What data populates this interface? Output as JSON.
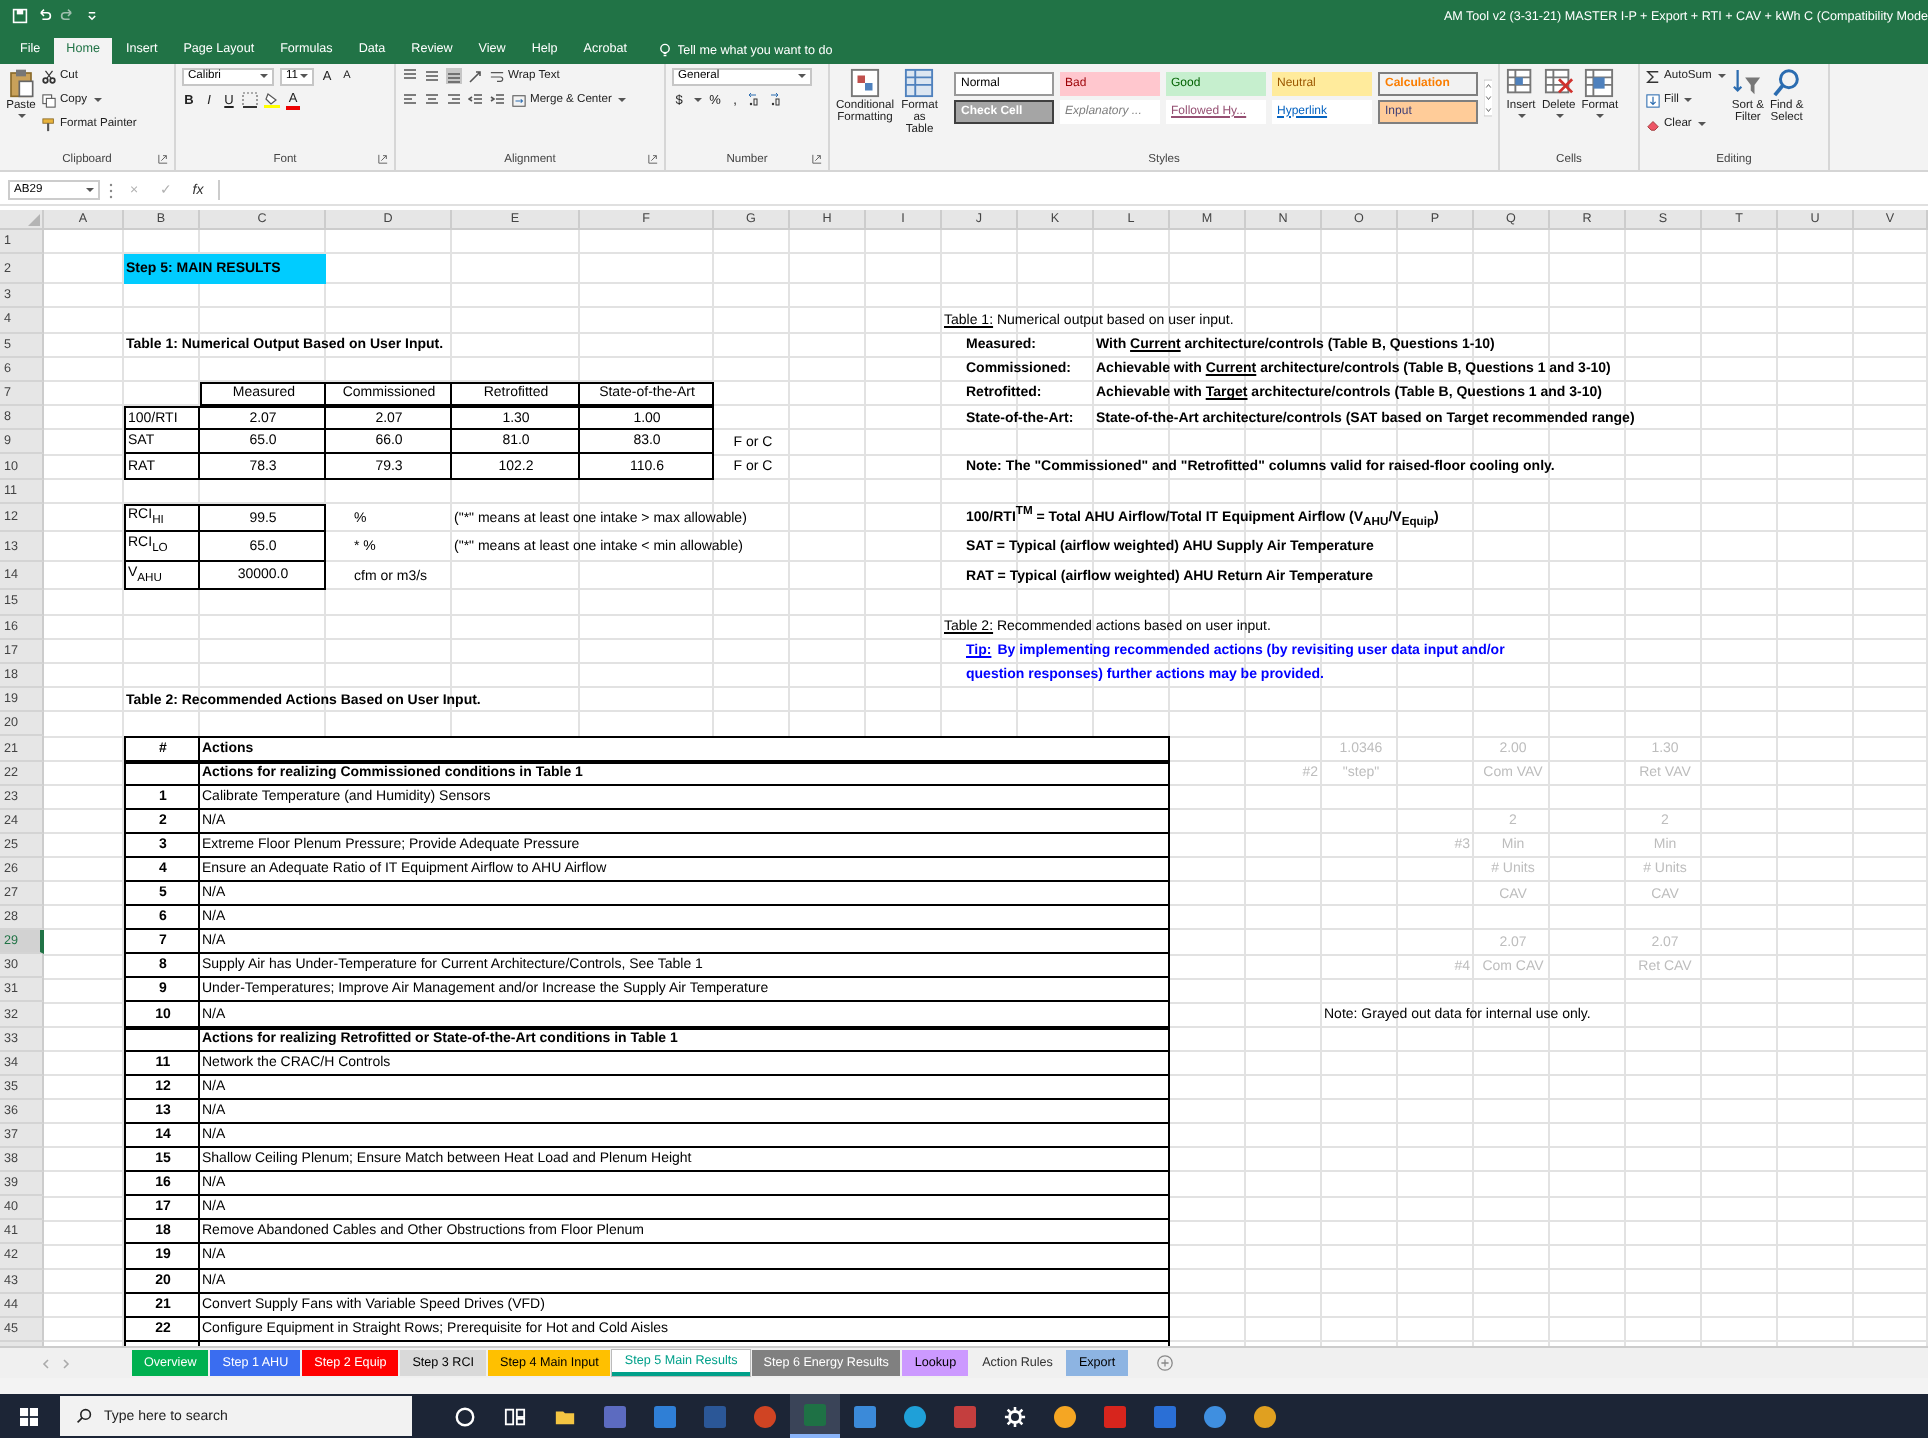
{
  "window": {
    "title": "AM Tool v2  (3-31-21) MASTER I-P + Export + RTI + CAV + kWh C  (Compatibility Mode"
  },
  "menu_tabs": [
    {
      "label": "File",
      "selected": false
    },
    {
      "label": "Home",
      "selected": true
    },
    {
      "label": "Insert",
      "selected": false
    },
    {
      "label": "Page Layout",
      "selected": false
    },
    {
      "label": "Formulas",
      "selected": false
    },
    {
      "label": "Data",
      "selected": false
    },
    {
      "label": "Review",
      "selected": false
    },
    {
      "label": "View",
      "selected": false
    },
    {
      "label": "Help",
      "selected": false
    },
    {
      "label": "Acrobat",
      "selected": false
    }
  ],
  "tell_me": {
    "placeholder": "Tell me what you want to do"
  },
  "ribbon": {
    "clipboard": {
      "paste": "Paste",
      "cut": "Cut",
      "copy": "Copy",
      "format_painter": "Format Painter",
      "label": "Clipboard"
    },
    "font": {
      "name": "Calibri",
      "size": "11",
      "grow": "A",
      "shrink": "A",
      "bold": "B",
      "italic": "I",
      "underline": "U",
      "color_letter": "A",
      "label": "Font"
    },
    "alignment": {
      "wrap_text": "Wrap Text",
      "merge": "Merge & Center",
      "label": "Alignment"
    },
    "number": {
      "format": "General",
      "currency": "$",
      "percent": "%",
      "comma": ",",
      "label": "Number"
    },
    "styles": {
      "conditional": [
        "Conditional",
        "Formatting"
      ],
      "format_table": [
        "Format as",
        "Table"
      ],
      "label": "Styles",
      "cells": [
        {
          "label": "Normal",
          "kind": "normal"
        },
        {
          "label": "Bad",
          "kind": "bad"
        },
        {
          "label": "Good",
          "kind": "good"
        },
        {
          "label": "Neutral",
          "kind": "neutral"
        },
        {
          "label": "Calculation",
          "kind": "calculation"
        },
        {
          "label": "Check Cell",
          "kind": "check"
        },
        {
          "label": "Explanatory ...",
          "kind": "explanatory"
        },
        {
          "label": "Followed Hy...",
          "kind": "followed"
        },
        {
          "label": "Hyperlink",
          "kind": "hyperlink"
        },
        {
          "label": "Input",
          "kind": "input"
        }
      ]
    },
    "cells": {
      "insert": "Insert",
      "delete": "Delete",
      "format": "Format",
      "label": "Cells"
    },
    "editing": {
      "autosum": "AutoSum",
      "fill": "Fill",
      "clear": "Clear",
      "sort": [
        "Sort &",
        "Filter"
      ],
      "find": [
        "Find &",
        "Select"
      ],
      "label": "Editing"
    }
  },
  "formula_bar": {
    "name_box": "AB29",
    "cancel": "×",
    "enter": "✓",
    "function": "fx"
  },
  "sheet": {
    "columns": [
      "A",
      "B",
      "C",
      "D",
      "E",
      "F",
      "G",
      "H",
      "I",
      "J",
      "K",
      "L",
      "M",
      "N",
      "O",
      "P",
      "Q",
      "R",
      "S",
      "T",
      "U",
      "V"
    ],
    "rows": [
      {
        "label": "1",
        "selected": false
      },
      {
        "label": "2",
        "selected": false
      },
      {
        "label": "3",
        "selected": false
      },
      {
        "label": "4",
        "selected": false
      },
      {
        "label": "5",
        "selected": false
      },
      {
        "label": "6",
        "selected": false
      },
      {
        "label": "7",
        "selected": false
      },
      {
        "label": "8",
        "selected": false
      },
      {
        "label": "9",
        "selected": false
      },
      {
        "label": "10",
        "selected": false
      },
      {
        "label": "11",
        "selected": false
      },
      {
        "label": "12",
        "selected": false
      },
      {
        "label": "13",
        "selected": false
      },
      {
        "label": "14",
        "selected": false
      },
      {
        "label": "15",
        "selected": false
      },
      {
        "label": "16",
        "selected": false
      },
      {
        "label": "17",
        "selected": false
      },
      {
        "label": "18",
        "selected": false
      },
      {
        "label": "19",
        "selected": false
      },
      {
        "label": "20",
        "selected": false
      },
      {
        "label": "21",
        "selected": false
      },
      {
        "label": "22",
        "selected": false
      },
      {
        "label": "23",
        "selected": false
      },
      {
        "label": "24",
        "selected": false
      },
      {
        "label": "25",
        "selected": false
      },
      {
        "label": "26",
        "selected": false
      },
      {
        "label": "27",
        "selected": false
      },
      {
        "label": "28",
        "selected": false
      },
      {
        "label": "29",
        "selected": true
      },
      {
        "label": "30",
        "selected": false
      },
      {
        "label": "31",
        "selected": false
      },
      {
        "label": "32",
        "selected": false
      },
      {
        "label": "33",
        "selected": false
      },
      {
        "label": "34",
        "selected": false
      },
      {
        "label": "35",
        "selected": false
      },
      {
        "label": "36",
        "selected": false
      },
      {
        "label": "37",
        "selected": false
      },
      {
        "label": "38",
        "selected": false
      },
      {
        "label": "39",
        "selected": false
      },
      {
        "label": "40",
        "selected": false
      },
      {
        "label": "41",
        "selected": false
      },
      {
        "label": "42",
        "selected": false
      },
      {
        "label": "43",
        "selected": false
      },
      {
        "label": "44",
        "selected": false
      },
      {
        "label": "45",
        "selected": false
      }
    ],
    "banner": "Step 5: MAIN RESULTS",
    "table1": {
      "title": "Table 1: Numerical Output Based on User Input.",
      "columns": [
        "Measured",
        "Commissioned",
        "Retrofitted",
        "State-of-the-Art"
      ],
      "rows": [
        {
          "label": "100/RTI",
          "values": [
            "2.07",
            "2.07",
            "1.30",
            "1.00"
          ]
        },
        {
          "label": "SAT",
          "values": [
            "65.0",
            "66.0",
            "81.0",
            "83.0"
          ],
          "unit": "F or C"
        },
        {
          "label": "RAT",
          "values": [
            "78.3",
            "79.3",
            "102.2",
            "110.6"
          ],
          "unit": "F or C"
        }
      ]
    },
    "indices": [
      {
        "label": "RCI$_{HI}$",
        "value": "99.5",
        "unit": "%",
        "note": "(\"*\" means at least one intake > max allowable)"
      },
      {
        "label": "RCI$_{LO}$",
        "value": "65.0",
        "unit": "* %",
        "note": "(\"*\" means at least one intake < min allowable)"
      },
      {
        "label": "V$_{AHU}$",
        "value": "30000.0",
        "unit": "cfm or m3/s"
      }
    ],
    "table2": {
      "title": "Table 2: Recommended Actions Based on User Input.",
      "columns": [
        "#",
        "Actions"
      ],
      "rows": [
        {
          "kind": "section",
          "text": "Actions for realizing Commissioned conditions in Table 1"
        },
        {
          "kind": "action",
          "number": "1",
          "text": "Calibrate Temperature (and Humidity) Sensors"
        },
        {
          "kind": "action",
          "number": "2",
          "text": "N/A"
        },
        {
          "kind": "action",
          "number": "3",
          "text": "Extreme Floor Plenum Pressure; Provide Adequate Pressure"
        },
        {
          "kind": "action",
          "number": "4",
          "text": "Ensure an Adequate Ratio of IT Equipment Airflow to AHU Airflow"
        },
        {
          "kind": "action",
          "number": "5",
          "text": "N/A"
        },
        {
          "kind": "action",
          "number": "6",
          "text": "N/A"
        },
        {
          "kind": "action",
          "number": "7",
          "text": "N/A"
        },
        {
          "kind": "action",
          "number": "8",
          "text": "Supply Air has Under-Temperature for Current Architecture/Controls, See Table 1"
        },
        {
          "kind": "action",
          "number": "9",
          "text": "Under-Temperatures; Improve Air Management and/or Increase the Supply Air Temperature"
        },
        {
          "kind": "action",
          "number": "10",
          "text": "N/A"
        },
        {
          "kind": "section",
          "text": "Actions for realizing Retrofitted or State-of-the-Art conditions in Table 1"
        },
        {
          "kind": "action",
          "number": "11",
          "text": "Network the CRAC/H Controls"
        },
        {
          "kind": "action",
          "number": "12",
          "text": "N/A"
        },
        {
          "kind": "action",
          "number": "13",
          "text": "N/A"
        },
        {
          "kind": "action",
          "number": "14",
          "text": "N/A"
        },
        {
          "kind": "action",
          "number": "15",
          "text": "Shallow Ceiling Plenum; Ensure Match between Heat Load and Plenum Height"
        },
        {
          "kind": "action",
          "number": "16",
          "text": "N/A"
        },
        {
          "kind": "action",
          "number": "17",
          "text": "N/A"
        },
        {
          "kind": "action",
          "number": "18",
          "text": "Remove Abandoned Cables and Other Obstructions from Floor Plenum"
        },
        {
          "kind": "action",
          "number": "19",
          "text": "N/A"
        },
        {
          "kind": "action",
          "number": "20",
          "text": "N/A"
        },
        {
          "kind": "action",
          "number": "21",
          "text": "Convert Supply Fans with Variable Speed Drives (VFD)"
        },
        {
          "kind": "action",
          "number": "22",
          "text": "Configure Equipment in Straight Rows; Prerequisite for Hot and Cold Aisles"
        }
      ]
    },
    "legend": {
      "table1_heading": "Table 1:",
      "table1_text": " Numerical output based on user input.",
      "definitions": [
        {
          "label": "Measured:",
          "before": "With ",
          "underlined": "Current",
          "after": " architecture/controls (Table B, Questions 1-10)"
        },
        {
          "label": "Commissioned:",
          "before": "Achievable with ",
          "underlined": "Current",
          "after": " architecture/controls (Table B, Questions 1 and 3-10)"
        },
        {
          "label": "Retrofitted:",
          "before": "Achievable with ",
          "underlined": "Target",
          "after": " architecture/controls (Table B, Questions 1 and 3-10)"
        },
        {
          "label": "State-of-the-Art:",
          "before": "State-of-the-Art architecture/controls (SAT based on Target recommended range)"
        }
      ],
      "note": "Note: The \"Commissioned\" and \"Retrofitted\" columns valid for raised-floor cooling only.",
      "formulas": [
        "100/RTI$^{TM}$ = Total AHU Airflow/Total IT Equipment Airflow (V$_{AHU}$/V$_{Equip}$)",
        "SAT = Typical (airflow weighted) AHU Supply Air Temperature",
        "RAT = Typical (airflow weighted) AHU Return Air Temperature"
      ],
      "table2_heading": "Table 2:",
      "table2_text": " Recommended actions based on user input.",
      "tip": {
        "label": "Tip:",
        "lines": [
          "By implementing recommended actions (by revisiting user data input and/or",
          "question responses) further actions may be provided."
        ]
      }
    },
    "internal_data": {
      "blocks": [
        {
          "tag": "#2",
          "step": [
            "1.0346",
            "\"step\""
          ],
          "commissioned": [
            "2.00",
            "Com VAV"
          ],
          "retrofitted": [
            "1.30",
            "Ret VAV"
          ]
        },
        {
          "tag": "#3",
          "commissioned": [
            "2",
            "Min",
            "# Units",
            "CAV"
          ],
          "retrofitted": [
            "2",
            "Min",
            "# Units",
            "CAV"
          ]
        },
        {
          "tag": "#4",
          "commissioned": [
            "2.07",
            "Com CAV"
          ],
          "retrofitted": [
            "2.07",
            "Ret CAV"
          ]
        }
      ],
      "note": "Note: Grayed out data for internal use only."
    }
  },
  "sheet_tabs": [
    {
      "label": "Overview",
      "color": "#00b050",
      "selected": false
    },
    {
      "label": "Step 1 AHU",
      "color": "#3a6df0",
      "selected": false
    },
    {
      "label": "Step 2 Equip",
      "color": "#ff0000",
      "selected": false
    },
    {
      "label": "Step 3 RCI",
      "color": "#d9d9d9",
      "selected": false
    },
    {
      "label": "Step 4 Main Input",
      "color": "#ffc000",
      "selected": false
    },
    {
      "label": "Step 5 Main Results",
      "color": "#00a08a",
      "selected": true
    },
    {
      "label": "Step 6 Energy Results",
      "color": "#808080",
      "selected": false
    },
    {
      "label": "Lookup",
      "color": "#cc99ff",
      "selected": false
    },
    {
      "label": "Action Rules",
      "selected": false
    },
    {
      "label": "Export",
      "color": "#8db4e2",
      "selected": false
    }
  ],
  "taskbar": {
    "search": {
      "placeholder": "Type here to search"
    },
    "apps": [
      {
        "kind": "ring",
        "color": "#ffffff",
        "selected": false
      },
      {
        "kind": "split",
        "color": "#ffffff",
        "selected": false
      },
      {
        "kind": "folder",
        "color": "#f4c542",
        "selected": false
      },
      {
        "kind": "square",
        "color": "#5c6bc0",
        "selected": false
      },
      {
        "kind": "square",
        "color": "#2f7fd6",
        "selected": false
      },
      {
        "kind": "square",
        "color": "#2b5797",
        "selected": false
      },
      {
        "kind": "round",
        "color": "#d04423",
        "selected": false
      },
      {
        "kind": "square",
        "color": "#1e7145",
        "selected": true
      },
      {
        "kind": "square",
        "color": "#3b8ad9",
        "selected": false
      },
      {
        "kind": "round",
        "color": "#1fa0d8",
        "selected": false
      },
      {
        "kind": "square",
        "color": "#c43e3e",
        "selected": false
      },
      {
        "kind": "gear",
        "color": "#ffffff",
        "selected": false
      },
      {
        "kind": "round",
        "color": "#f5a623",
        "selected": false
      },
      {
        "kind": "square",
        "color": "#d7251d",
        "selected": false
      },
      {
        "kind": "square",
        "color": "#2a6fd6",
        "selected": false
      },
      {
        "kind": "round",
        "color": "#3f8fe0",
        "selected": false
      },
      {
        "kind": "round",
        "color": "#e0a020",
        "selected": false
      }
    ]
  }
}
